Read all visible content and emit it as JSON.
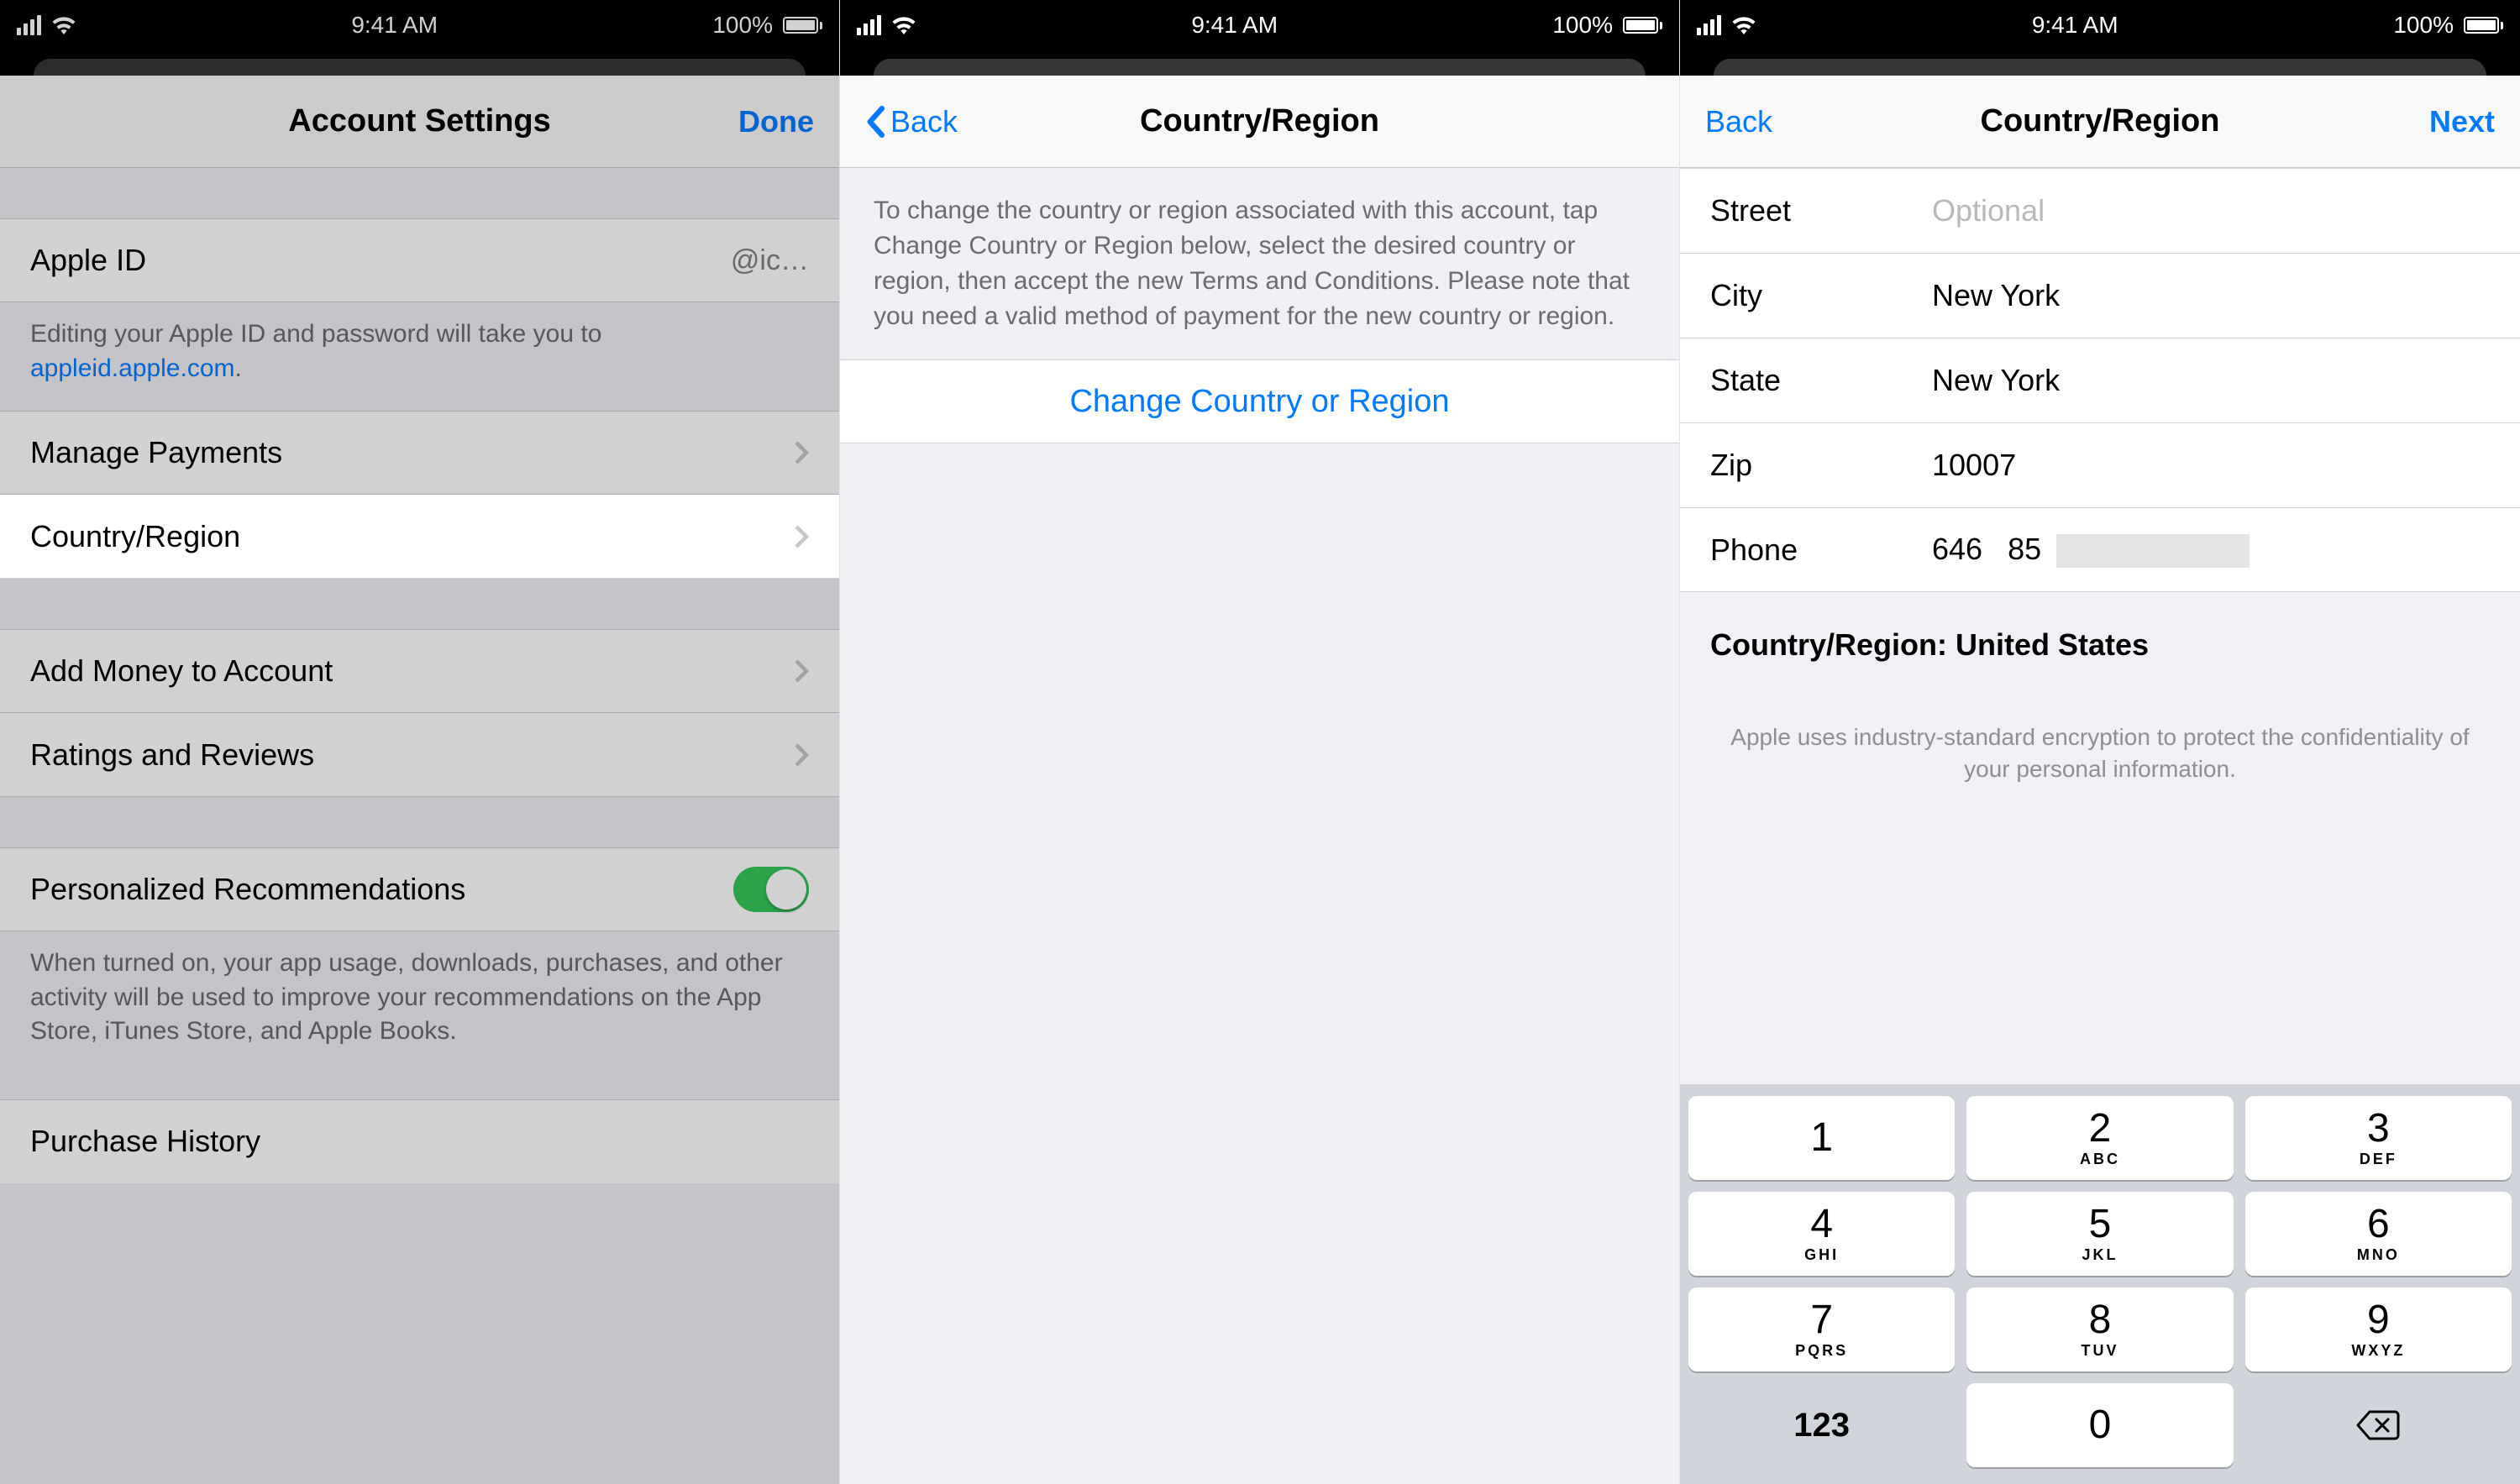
{
  "statusbar": {
    "time": "9:41 AM",
    "battery_text": "100%"
  },
  "screen1": {
    "title": "Account Settings",
    "done": "Done",
    "apple_id_label": "Apple ID",
    "apple_id_value": "@ic…",
    "apple_id_foot_pre": "Editing your Apple ID and password will take you to ",
    "apple_id_link": "appleid.apple.com",
    "apple_id_foot_post": ".",
    "manage_payments": "Manage Payments",
    "country_region": "Country/Region",
    "add_money": "Add Money to Account",
    "ratings": "Ratings and Reviews",
    "personalized": "Personalized Recommendations",
    "personalized_foot": "When turned on, your app usage, downloads, purchases, and other activity will be used to improve your recommendations on the App Store, iTunes Store, and Apple Books.",
    "purchase_history": "Purchase History"
  },
  "screen2": {
    "back": "Back",
    "title": "Country/Region",
    "explainer": "To change the country or region associated with this account, tap Change Country or Region below, select the desired country or region, then accept the new Terms and Conditions. Please note that you need a valid method of payment for the new country or region.",
    "change": "Change Country or Region"
  },
  "screen3": {
    "back": "Back",
    "title": "Country/Region",
    "next": "Next",
    "fields": {
      "street_label": "Street",
      "street_placeholder": "Optional",
      "street_value": "",
      "city_label": "City",
      "city_value": "New York",
      "state_label": "State",
      "state_value": "New York",
      "zip_label": "Zip",
      "zip_value": "10007",
      "phone_label": "Phone",
      "phone_area": "646",
      "phone_partial": "85"
    },
    "country_header": "Country/Region: United States",
    "encryption_note": "Apple uses industry-standard encryption to protect the confidentiality of your personal information.",
    "keypad": [
      {
        "d": "1",
        "l": ""
      },
      {
        "d": "2",
        "l": "ABC"
      },
      {
        "d": "3",
        "l": "DEF"
      },
      {
        "d": "4",
        "l": "GHI"
      },
      {
        "d": "5",
        "l": "JKL"
      },
      {
        "d": "6",
        "l": "MNO"
      },
      {
        "d": "7",
        "l": "PQRS"
      },
      {
        "d": "8",
        "l": "TUV"
      },
      {
        "d": "9",
        "l": "WXYZ"
      },
      {
        "d": "123",
        "l": "",
        "plain": true
      },
      {
        "d": "0",
        "l": ""
      },
      {
        "d": "⌫",
        "l": "",
        "plain": true,
        "icon": true
      }
    ]
  }
}
